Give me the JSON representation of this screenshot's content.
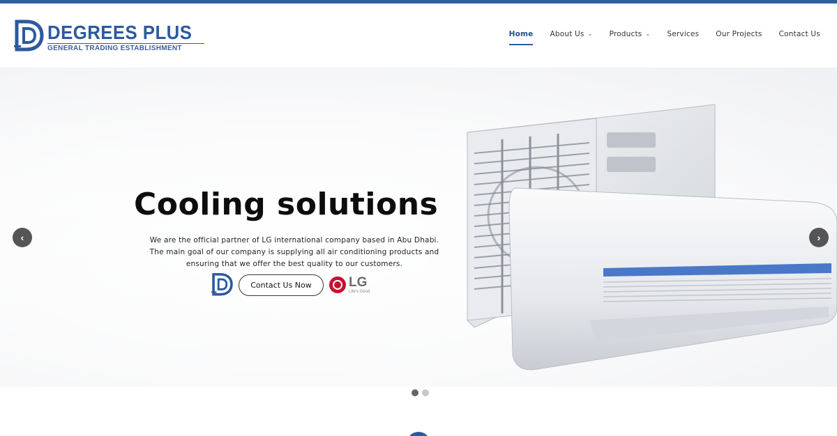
{
  "brand": {
    "name": "DEGREES PLUS",
    "subtitle": "GENERAL TRADING ESTABLISHMENT",
    "color": "#2c5aa0"
  },
  "nav": {
    "items": [
      {
        "label": "Home",
        "active": true
      },
      {
        "label": "About Us",
        "dropdown": true
      },
      {
        "label": "Products",
        "dropdown": true
      },
      {
        "label": "Services"
      },
      {
        "label": "Our Projects"
      },
      {
        "label": "Contact Us"
      }
    ]
  },
  "hero": {
    "title": "Cooling solutions",
    "description": "We are the official partner of LG international company based in Abu Dhabi. The main goal of our company is supplying all air conditioning products and ensuring that we offer the best quality to our customers.",
    "cta_label": "Contact Us Now",
    "partner": {
      "name": "LG",
      "tagline": "Life's Good",
      "color": "#c8102e"
    },
    "prev_icon": "chevron-left-icon",
    "next_icon": "chevron-right-icon",
    "slides_total": 2,
    "active_slide": 1
  }
}
